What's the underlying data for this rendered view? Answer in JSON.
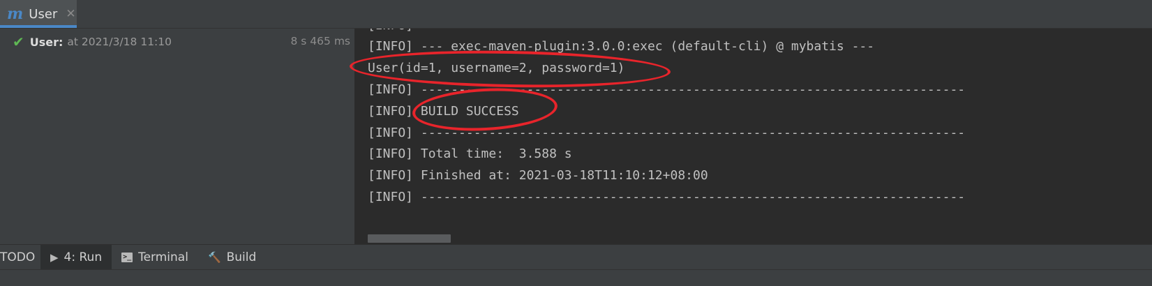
{
  "tab": {
    "icon": "maven-icon",
    "label": "User",
    "close_glyph": "✕"
  },
  "run_tree": {
    "status_icon": "check-icon",
    "name": "User:",
    "time": "at 2021/3/18 11:10",
    "duration": "8 s 465 ms"
  },
  "console": {
    "lines": [
      "[INFO]",
      "[INFO] --- exec-maven-plugin:3.0.0:exec (default-cli) @ mybatis ---",
      "User(id=1, username=2, password=1)",
      "[INFO] ------------------------------------------------------------------------",
      "[INFO] BUILD SUCCESS",
      "[INFO] ------------------------------------------------------------------------",
      "[INFO] Total time:  3.588 s",
      "[INFO] Finished at: 2021-03-18T11:10:12+08:00",
      "[INFO] ------------------------------------------------------------------------"
    ]
  },
  "annotation_color": "#e8242b",
  "bottom_tabs": [
    {
      "label": "TODO",
      "icon": ""
    },
    {
      "label": "4: Run",
      "icon": "play-icon"
    },
    {
      "label": "Terminal",
      "icon": "terminal-icon"
    },
    {
      "label": "Build",
      "icon": "hammer-icon"
    }
  ]
}
